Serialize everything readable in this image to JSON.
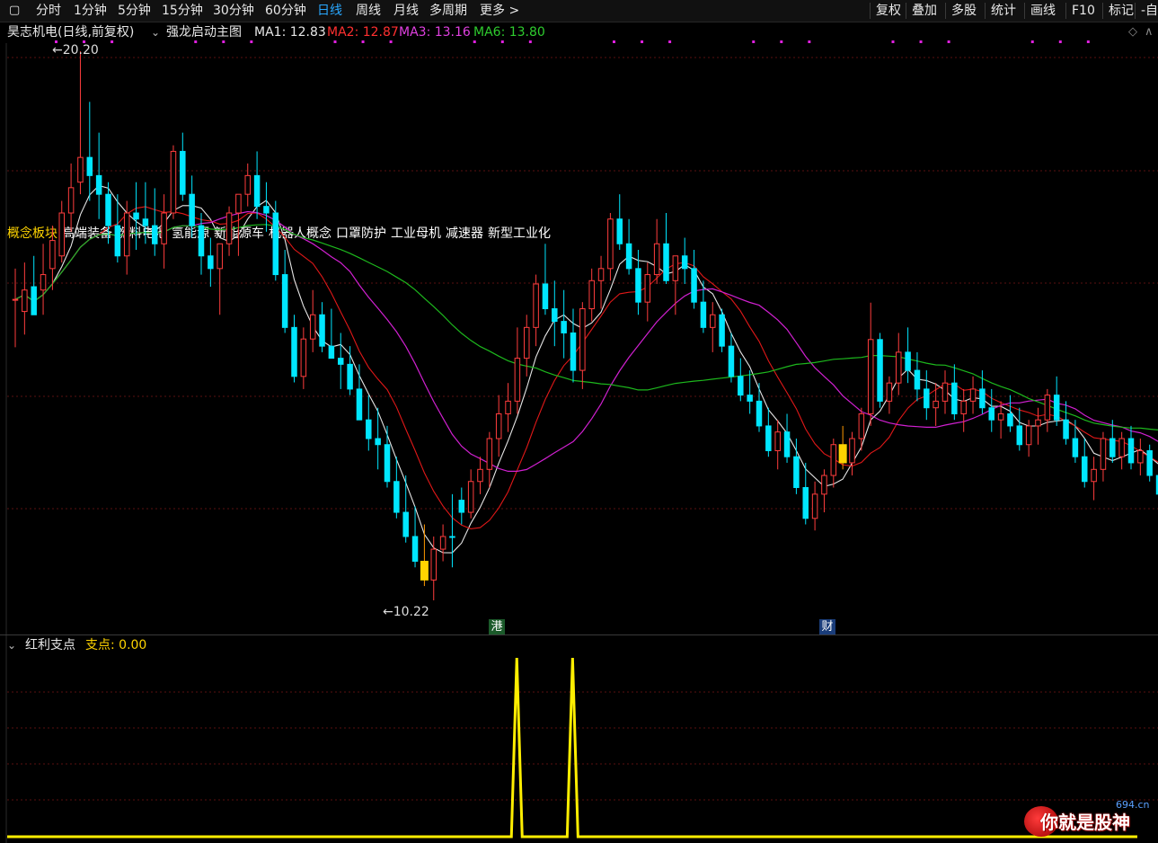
{
  "toolbar": {
    "square_icon": "square-icon",
    "periods": [
      "分时",
      "1分钟",
      "5分钟",
      "15分钟",
      "30分钟",
      "60分钟",
      "日线",
      "周线",
      "月线",
      "多周期",
      "更多 >"
    ],
    "active_period": "日线",
    "tools": [
      "复权",
      "叠加",
      "多股",
      "统计",
      "画线",
      "F10",
      "标记",
      "-自"
    ]
  },
  "info_bar": {
    "stock_name": "昊志机电(日线,前复权)",
    "indicator_name": "强龙启动主图",
    "ma1": "MA1: 12.83",
    "ma2": "MA2: 12.87",
    "ma3": "MA3: 13.16",
    "ma6": "MA6: 13.80"
  },
  "concepts": {
    "label": "概念板块",
    "items": [
      "高端装备",
      "燃料电池",
      "氢能源",
      "新能源车",
      "机器人概念",
      "口罩防护",
      "工业母机",
      "减速器",
      "新型工业化"
    ]
  },
  "price_marks": {
    "high": "20.20",
    "low": "10.22"
  },
  "event_markers": {
    "port": "港",
    "finance": "财"
  },
  "sub_panel": {
    "name": "红利支点",
    "value_label": "支点: 0.00"
  },
  "watermark": {
    "text": "你就是股神",
    "site": "694.cn"
  },
  "colors": {
    "up": "#ff3d3d",
    "down": "#00e6ff",
    "signal": "#ffd400",
    "ma1": "#e6e6e6",
    "ma2": "#e01818",
    "ma3": "#d020d0",
    "ma6": "#1db81d",
    "sub_line": "#ffee00",
    "active": "#29a8ff"
  },
  "chart_data": {
    "type": "candlestick",
    "title": "昊志机电(日线,前复权)",
    "y_range": [
      10.22,
      20.2
    ],
    "annotations": {
      "high": 20.2,
      "low": 10.22
    },
    "candles": [
      [
        15.69,
        16.25,
        14.82,
        15.69
      ],
      [
        15.47,
        16.36,
        15.05,
        15.86
      ],
      [
        15.92,
        16.48,
        15.41,
        15.41
      ],
      [
        15.86,
        16.7,
        15.41,
        16.14
      ],
      [
        16.25,
        17.03,
        15.86,
        16.76
      ],
      [
        16.48,
        17.48,
        16.36,
        17.26
      ],
      [
        17.26,
        18.16,
        16.92,
        17.72
      ],
      [
        17.82,
        20.2,
        17.6,
        18.27
      ],
      [
        18.27,
        19.28,
        17.48,
        17.94
      ],
      [
        17.94,
        18.72,
        17.15,
        17.6
      ],
      [
        17.6,
        17.82,
        16.7,
        17.03
      ],
      [
        17.03,
        17.6,
        16.36,
        16.48
      ],
      [
        16.48,
        17.48,
        16.14,
        17.26
      ],
      [
        17.26,
        17.82,
        16.59,
        17.15
      ],
      [
        17.15,
        17.82,
        16.7,
        17.03
      ],
      [
        17.03,
        17.71,
        16.48,
        16.7
      ],
      [
        16.7,
        17.6,
        16.25,
        17.26
      ],
      [
        17.26,
        18.49,
        17.15,
        18.38
      ],
      [
        18.38,
        18.72,
        17.48,
        17.6
      ],
      [
        17.6,
        17.94,
        16.81,
        17.03
      ],
      [
        17.03,
        17.26,
        16.14,
        16.48
      ],
      [
        16.48,
        16.81,
        15.92,
        16.25
      ],
      [
        16.25,
        16.48,
        15.41,
        16.7
      ],
      [
        16.7,
        17.38,
        16.48,
        17.26
      ],
      [
        17.26,
        17.6,
        16.48,
        17.6
      ],
      [
        17.6,
        18.16,
        17.38,
        17.94
      ],
      [
        17.94,
        18.38,
        17.15,
        17.38
      ],
      [
        17.38,
        17.82,
        16.92,
        17.26
      ],
      [
        17.26,
        17.48,
        16.03,
        16.14
      ],
      [
        16.14,
        16.59,
        15.08,
        15.18
      ],
      [
        15.18,
        15.41,
        14.18,
        14.29
      ],
      [
        14.29,
        15.18,
        14.06,
        14.97
      ],
      [
        14.97,
        15.86,
        14.73,
        15.41
      ],
      [
        15.41,
        15.64,
        14.73,
        14.84
      ],
      [
        14.84,
        15.52,
        14.62,
        14.62
      ],
      [
        14.62,
        15.08,
        14.06,
        14.51
      ],
      [
        14.51,
        14.84,
        13.95,
        14.06
      ],
      [
        14.06,
        14.51,
        13.72,
        13.5
      ],
      [
        13.5,
        13.95,
        12.94,
        13.16
      ],
      [
        13.16,
        13.72,
        12.6,
        13.05
      ],
      [
        13.05,
        13.39,
        12.27,
        12.38
      ],
      [
        12.38,
        12.83,
        11.71,
        11.82
      ],
      [
        11.82,
        12.49,
        11.27,
        11.38
      ],
      [
        11.38,
        11.93,
        10.82,
        10.93
      ],
      [
        10.93,
        11.6,
        10.48,
        10.59
      ],
      [
        10.59,
        11.38,
        10.22,
        11.15
      ],
      [
        11.15,
        11.6,
        10.93,
        11.38
      ],
      [
        11.38,
        12.15,
        10.82,
        11.37
      ],
      [
        12.04,
        12.27,
        11.6,
        11.82
      ],
      [
        11.82,
        12.6,
        11.71,
        12.38
      ],
      [
        12.38,
        12.83,
        12.15,
        12.6
      ],
      [
        12.6,
        13.28,
        12.27,
        13.16
      ],
      [
        13.16,
        13.95,
        12.83,
        13.61
      ],
      [
        13.61,
        14.17,
        13.28,
        13.84
      ],
      [
        13.84,
        15.18,
        13.61,
        14.62
      ],
      [
        14.62,
        15.41,
        14.29,
        15.18
      ],
      [
        15.18,
        16.14,
        14.84,
        15.97
      ],
      [
        15.97,
        16.7,
        15.41,
        15.52
      ],
      [
        15.52,
        16.03,
        14.84,
        15.29
      ],
      [
        15.29,
        15.86,
        14.62,
        15.08
      ],
      [
        15.08,
        15.52,
        14.18,
        14.4
      ],
      [
        14.4,
        15.64,
        14.06,
        15.52
      ],
      [
        15.52,
        16.25,
        15.29,
        16.03
      ],
      [
        16.03,
        16.48,
        15.52,
        16.25
      ],
      [
        16.25,
        17.26,
        16.03,
        17.15
      ],
      [
        17.15,
        17.6,
        16.59,
        16.7
      ],
      [
        16.7,
        17.15,
        16.14,
        16.25
      ],
      [
        16.25,
        16.59,
        15.41,
        15.64
      ],
      [
        15.64,
        16.36,
        15.29,
        16.14
      ],
      [
        16.14,
        17.15,
        15.97,
        16.7
      ],
      [
        16.7,
        17.26,
        15.97,
        16.03
      ],
      [
        16.03,
        16.48,
        15.41,
        16.48
      ],
      [
        16.48,
        16.81,
        15.97,
        16.25
      ],
      [
        16.25,
        16.59,
        15.52,
        15.64
      ],
      [
        15.64,
        16.03,
        15.08,
        15.18
      ],
      [
        15.18,
        15.64,
        14.73,
        15.41
      ],
      [
        15.41,
        15.52,
        14.73,
        14.84
      ],
      [
        14.84,
        15.08,
        14.18,
        14.29
      ],
      [
        14.29,
        14.62,
        13.84,
        13.95
      ],
      [
        13.95,
        14.4,
        13.61,
        13.84
      ],
      [
        13.84,
        14.17,
        13.28,
        13.39
      ],
      [
        13.39,
        13.72,
        12.83,
        12.94
      ],
      [
        12.94,
        13.5,
        12.6,
        13.28
      ],
      [
        13.28,
        13.61,
        12.72,
        12.83
      ],
      [
        12.83,
        13.16,
        12.15,
        12.27
      ],
      [
        12.27,
        12.72,
        11.6,
        11.71
      ],
      [
        11.71,
        12.38,
        11.49,
        12.15
      ],
      [
        12.15,
        12.6,
        11.82,
        12.49
      ],
      [
        12.49,
        13.16,
        12.27,
        13.05
      ],
      [
        13.05,
        13.39,
        12.6,
        12.72
      ],
      [
        12.72,
        13.28,
        12.49,
        13.16
      ],
      [
        13.16,
        13.72,
        12.94,
        13.61
      ],
      [
        13.61,
        15.63,
        13.39,
        14.96
      ],
      [
        14.96,
        15.08,
        13.72,
        13.84
      ],
      [
        13.84,
        14.29,
        13.61,
        14.17
      ],
      [
        14.17,
        15.08,
        13.95,
        14.73
      ],
      [
        14.73,
        15.18,
        14.17,
        14.4
      ],
      [
        14.4,
        14.73,
        13.84,
        14.06
      ],
      [
        14.06,
        14.4,
        13.5,
        13.72
      ],
      [
        13.72,
        14.17,
        13.39,
        13.84
      ],
      [
        13.84,
        14.4,
        13.61,
        14.17
      ],
      [
        14.17,
        14.51,
        13.5,
        13.61
      ],
      [
        13.61,
        14.06,
        13.28,
        13.84
      ],
      [
        13.84,
        14.29,
        13.61,
        14.06
      ],
      [
        14.06,
        14.4,
        13.61,
        13.72
      ],
      [
        13.72,
        14.06,
        13.28,
        13.5
      ],
      [
        13.5,
        13.84,
        13.16,
        13.61
      ],
      [
        13.61,
        13.95,
        13.28,
        13.39
      ],
      [
        13.39,
        13.72,
        12.94,
        13.05
      ],
      [
        13.05,
        13.5,
        12.83,
        13.39
      ],
      [
        13.39,
        13.72,
        13.05,
        13.5
      ],
      [
        13.5,
        14.06,
        13.28,
        13.95
      ],
      [
        13.95,
        14.29,
        13.39,
        13.5
      ],
      [
        13.5,
        13.84,
        13.05,
        13.16
      ],
      [
        13.16,
        13.5,
        12.72,
        12.83
      ],
      [
        12.83,
        13.16,
        12.27,
        12.38
      ],
      [
        12.38,
        12.83,
        12.04,
        12.6
      ],
      [
        12.6,
        13.28,
        12.38,
        13.16
      ],
      [
        13.16,
        13.5,
        12.72,
        12.83
      ],
      [
        12.83,
        13.28,
        12.6,
        13.16
      ],
      [
        13.16,
        13.39,
        12.6,
        12.72
      ],
      [
        12.72,
        13.16,
        12.49,
        12.94
      ],
      [
        12.94,
        13.05,
        12.38,
        12.49
      ],
      [
        12.49,
        12.72,
        12.04,
        12.15
      ]
    ],
    "signal_candles": [
      44,
      89
    ],
    "sub_series": {
      "name": "红利支点",
      "spikes": [
        55,
        61
      ],
      "baseline": 0
    }
  }
}
